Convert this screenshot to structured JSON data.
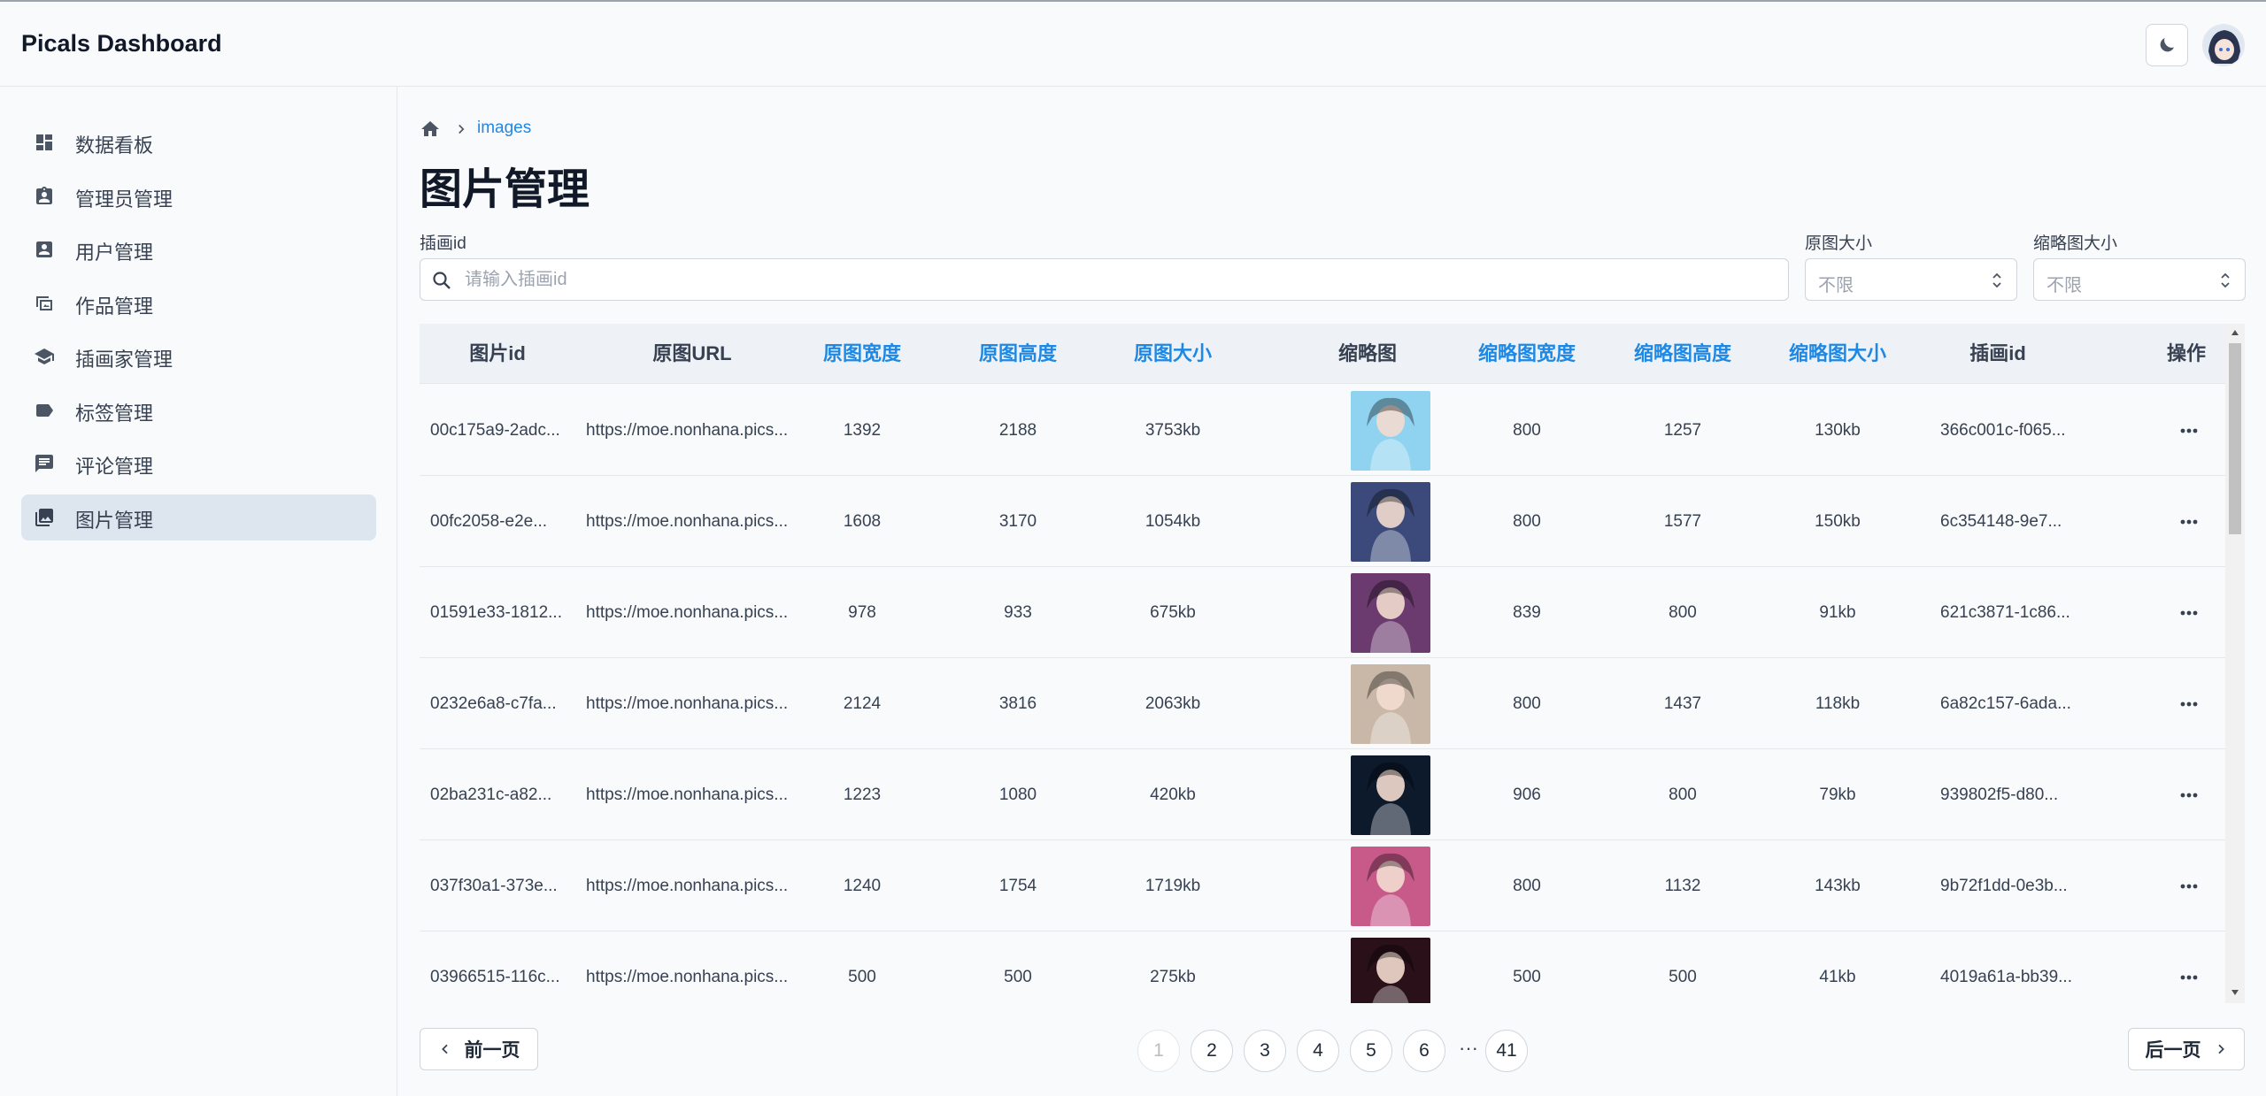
{
  "app": {
    "title": "Picals Dashboard",
    "theme_icon": "moon-icon",
    "avatar_icon": "user-avatar"
  },
  "sidebar": {
    "items": [
      {
        "label": "数据看板",
        "icon": "dashboard-icon",
        "active": false
      },
      {
        "label": "管理员管理",
        "icon": "admin-badge-icon",
        "active": false
      },
      {
        "label": "用户管理",
        "icon": "user-card-icon",
        "active": false
      },
      {
        "label": "作品管理",
        "icon": "artwork-icon",
        "active": false
      },
      {
        "label": "插画家管理",
        "icon": "school-cap-icon",
        "active": false
      },
      {
        "label": "标签管理",
        "icon": "label-icon",
        "active": false
      },
      {
        "label": "评论管理",
        "icon": "comment-icon",
        "active": false
      },
      {
        "label": "图片管理",
        "icon": "image-library-icon",
        "active": true
      }
    ]
  },
  "breadcrumb": {
    "home_icon": "home-icon",
    "current": "images"
  },
  "page": {
    "title": "图片管理"
  },
  "filters": {
    "illust_label": "插画id",
    "illust_placeholder": "请输入插画id",
    "orig_size_label": "原图大小",
    "orig_size_value": "不限",
    "thumb_size_label": "缩略图大小",
    "thumb_size_value": "不限"
  },
  "table": {
    "columns": [
      "图片id",
      "原图URL",
      "原图宽度",
      "原图高度",
      "原图大小",
      "缩略图",
      "缩略图宽度",
      "缩略图高度",
      "缩略图大小",
      "插画id",
      "操作"
    ],
    "sortable": [
      false,
      false,
      true,
      true,
      true,
      false,
      true,
      true,
      true,
      false,
      false
    ],
    "rows": [
      {
        "id": "00c175a9-2adc...",
        "url": "https://moe.nonhana.pics...",
        "w": "1392",
        "h": "2188",
        "size": "3753kb",
        "tw": "800",
        "th": "1257",
        "tsize": "130kb",
        "illust": "366c001c-f065..."
      },
      {
        "id": "00fc2058-e2e...",
        "url": "https://moe.nonhana.pics...",
        "w": "1608",
        "h": "3170",
        "size": "1054kb",
        "tw": "800",
        "th": "1577",
        "tsize": "150kb",
        "illust": "6c354148-9e7..."
      },
      {
        "id": "01591e33-1812...",
        "url": "https://moe.nonhana.pics...",
        "w": "978",
        "h": "933",
        "size": "675kb",
        "tw": "839",
        "th": "800",
        "tsize": "91kb",
        "illust": "621c3871-1c86..."
      },
      {
        "id": "0232e6a8-c7fa...",
        "url": "https://moe.nonhana.pics...",
        "w": "2124",
        "h": "3816",
        "size": "2063kb",
        "tw": "800",
        "th": "1437",
        "tsize": "118kb",
        "illust": "6a82c157-6ada..."
      },
      {
        "id": "02ba231c-a82...",
        "url": "https://moe.nonhana.pics...",
        "w": "1223",
        "h": "1080",
        "size": "420kb",
        "tw": "906",
        "th": "800",
        "tsize": "79kb",
        "illust": "939802f5-d80..."
      },
      {
        "id": "037f30a1-373e...",
        "url": "https://moe.nonhana.pics...",
        "w": "1240",
        "h": "1754",
        "size": "1719kb",
        "tw": "800",
        "th": "1132",
        "tsize": "143kb",
        "illust": "9b72f1dd-0e3b..."
      },
      {
        "id": "03966515-116c...",
        "url": "https://moe.nonhana.pics...",
        "w": "500",
        "h": "500",
        "size": "275kb",
        "tw": "500",
        "th": "500",
        "tsize": "41kb",
        "illust": "4019a61a-bb39..."
      }
    ],
    "thumb_colors": [
      "#8fd3f0",
      "#3b4a7a",
      "#6b3a6e",
      "#c9b8a8",
      "#0c1a2c",
      "#c85a8a",
      "#2a1018"
    ],
    "more_icon": "more-horizontal-icon"
  },
  "pagination": {
    "prev_label": "前一页",
    "next_label": "后一页",
    "pages": [
      "1",
      "2",
      "3",
      "4",
      "5",
      "6"
    ],
    "ellipsis": "···",
    "last": "41",
    "current": "1"
  },
  "colors": {
    "accent": "#1e88e5",
    "active_nav": "#dde6ee"
  }
}
